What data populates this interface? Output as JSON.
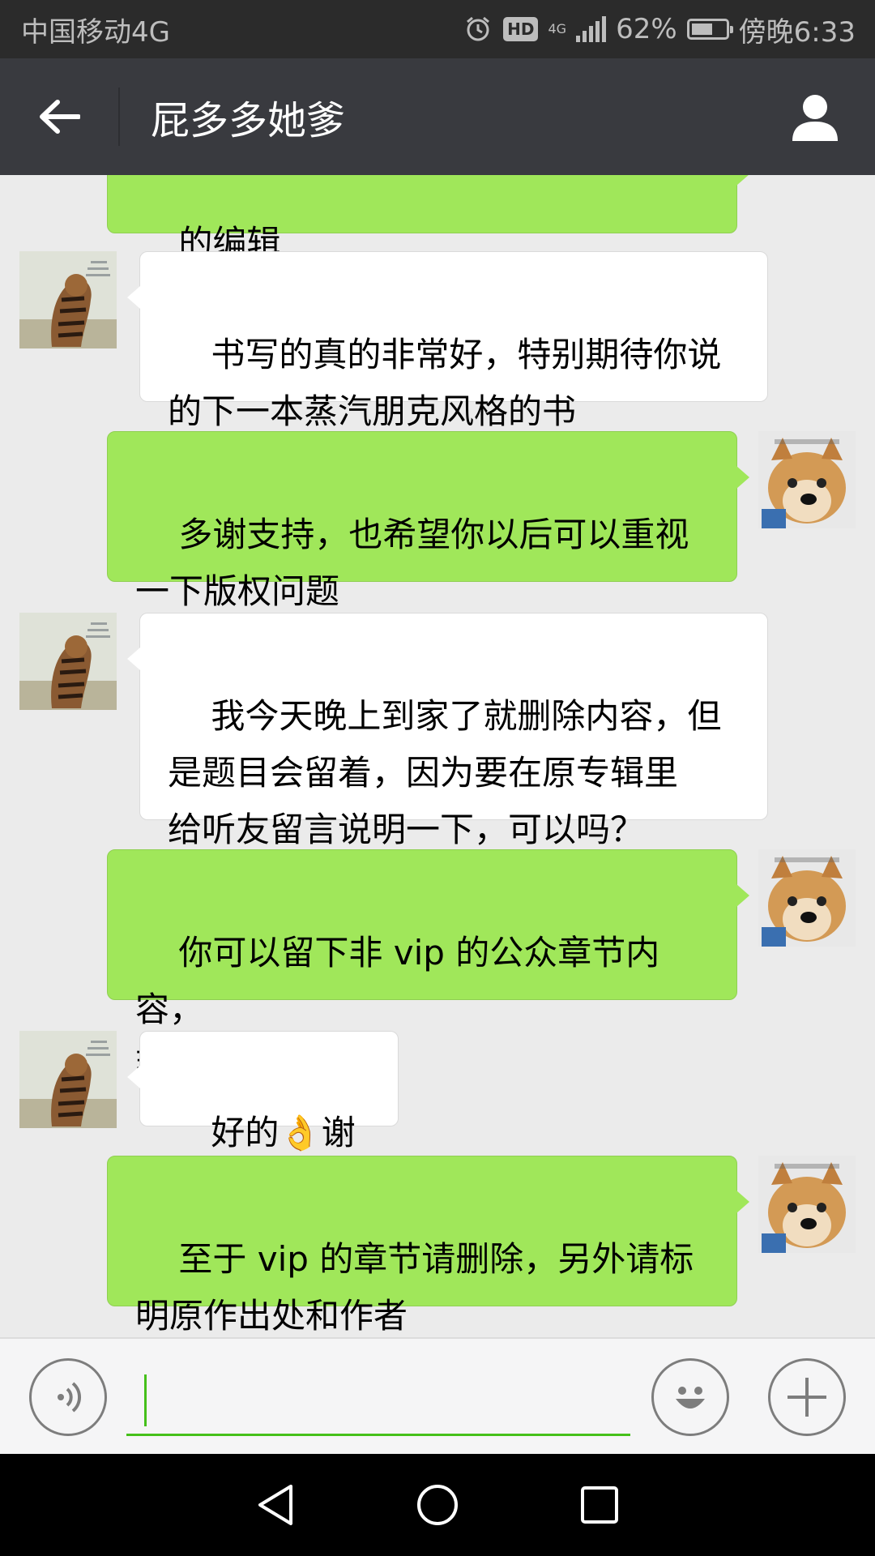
{
  "status_bar": {
    "carrier": "中国移动4G",
    "battery_percent": "62%",
    "battery_level": 0.62,
    "time": "傍晚6:33",
    "hd_label": "HD",
    "network_type": "4G",
    "icons": [
      "alarm-icon",
      "hd-icon",
      "signal-icon",
      "battery-icon"
    ]
  },
  "header": {
    "title": "屁多多她爹",
    "back_icon": "arrow-left-icon",
    "profile_icon": "person-icon"
  },
  "messages": [
    {
      "side": "out",
      "text": "的编辑",
      "avatar": "shiba-avatar"
    },
    {
      "side": "in",
      "text": "书写的真的非常好，特别期待你说\n的下一本蒸汽朋克风格的书",
      "avatar": "tiger-avatar"
    },
    {
      "side": "out",
      "text": "多谢支持，也希望你以后可以重视\n一下版权问题",
      "avatar": "shiba-avatar"
    },
    {
      "side": "in",
      "text": "我今天晚上到家了就删除内容，但\n是题目会留着，因为要在原专辑里\n给听友留言说明一下，可以吗？",
      "avatar": "tiger-avatar"
    },
    {
      "side": "out",
      "text": "你可以留下非 vip 的公众章节内容，\n那个我不会追究",
      "avatar": "shiba-avatar"
    },
    {
      "side": "in",
      "text_before": "好的",
      "emoji": "👌",
      "text_after": "谢谢",
      "avatar": "tiger-avatar"
    },
    {
      "side": "out",
      "text": "至于 vip 的章节请删除，另外请标\n明原作出处和作者",
      "avatar": "shiba-avatar"
    }
  ],
  "input_bar": {
    "voice_icon": "voice-icon",
    "emoji_icon": "smiley-icon",
    "plus_icon": "plus-icon",
    "value": ""
  },
  "nav_bar": {
    "icons": [
      "nav-back-icon",
      "nav-home-icon",
      "nav-recents-icon"
    ]
  },
  "colors": {
    "header_bg": "#393a3f",
    "status_bg": "#2b2b2b",
    "chat_bg": "#ebebeb",
    "outgoing_bubble": "#a0e75a",
    "incoming_bubble": "#ffffff",
    "accent": "#45c01a"
  }
}
